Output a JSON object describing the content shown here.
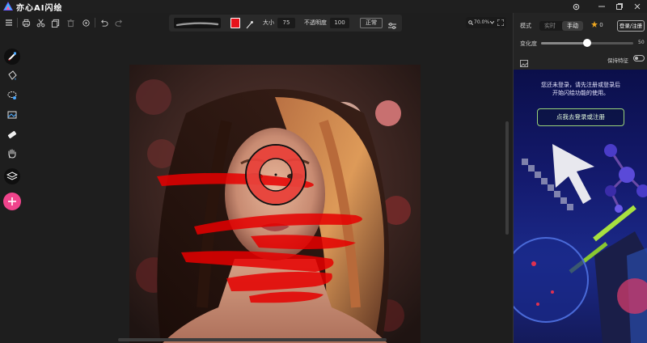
{
  "app": {
    "title": "亦心AI闪绘"
  },
  "window_controls": [
    "settings-icon",
    "minimize-icon",
    "restore-icon",
    "close-icon"
  ],
  "brush_bar": {
    "color": "#e6121b",
    "size_label": "大小",
    "size_value": "75",
    "opacity_label": "不透明度",
    "opacity_value": "100",
    "blend_mode": "正常"
  },
  "zoom": {
    "value": "70.0%"
  },
  "right_panel": {
    "mode_label": "模式",
    "mode_options": [
      "实时",
      "手动"
    ],
    "mode_selected": "手动",
    "credits": "0",
    "login_button": "登录/注册",
    "strength_label": "变化度",
    "strength_value": "50",
    "keep_features_label": "保持特征",
    "promo_line1": "您还未登录，请先注册或登录后",
    "promo_line2": "开始闪绘功能的使用。",
    "promo_button": "点我去登录或注册"
  },
  "colors": {
    "accent_pink": "#f0448c",
    "brush_red": "#e6121b",
    "promo_button_border": "#9bd37a"
  }
}
